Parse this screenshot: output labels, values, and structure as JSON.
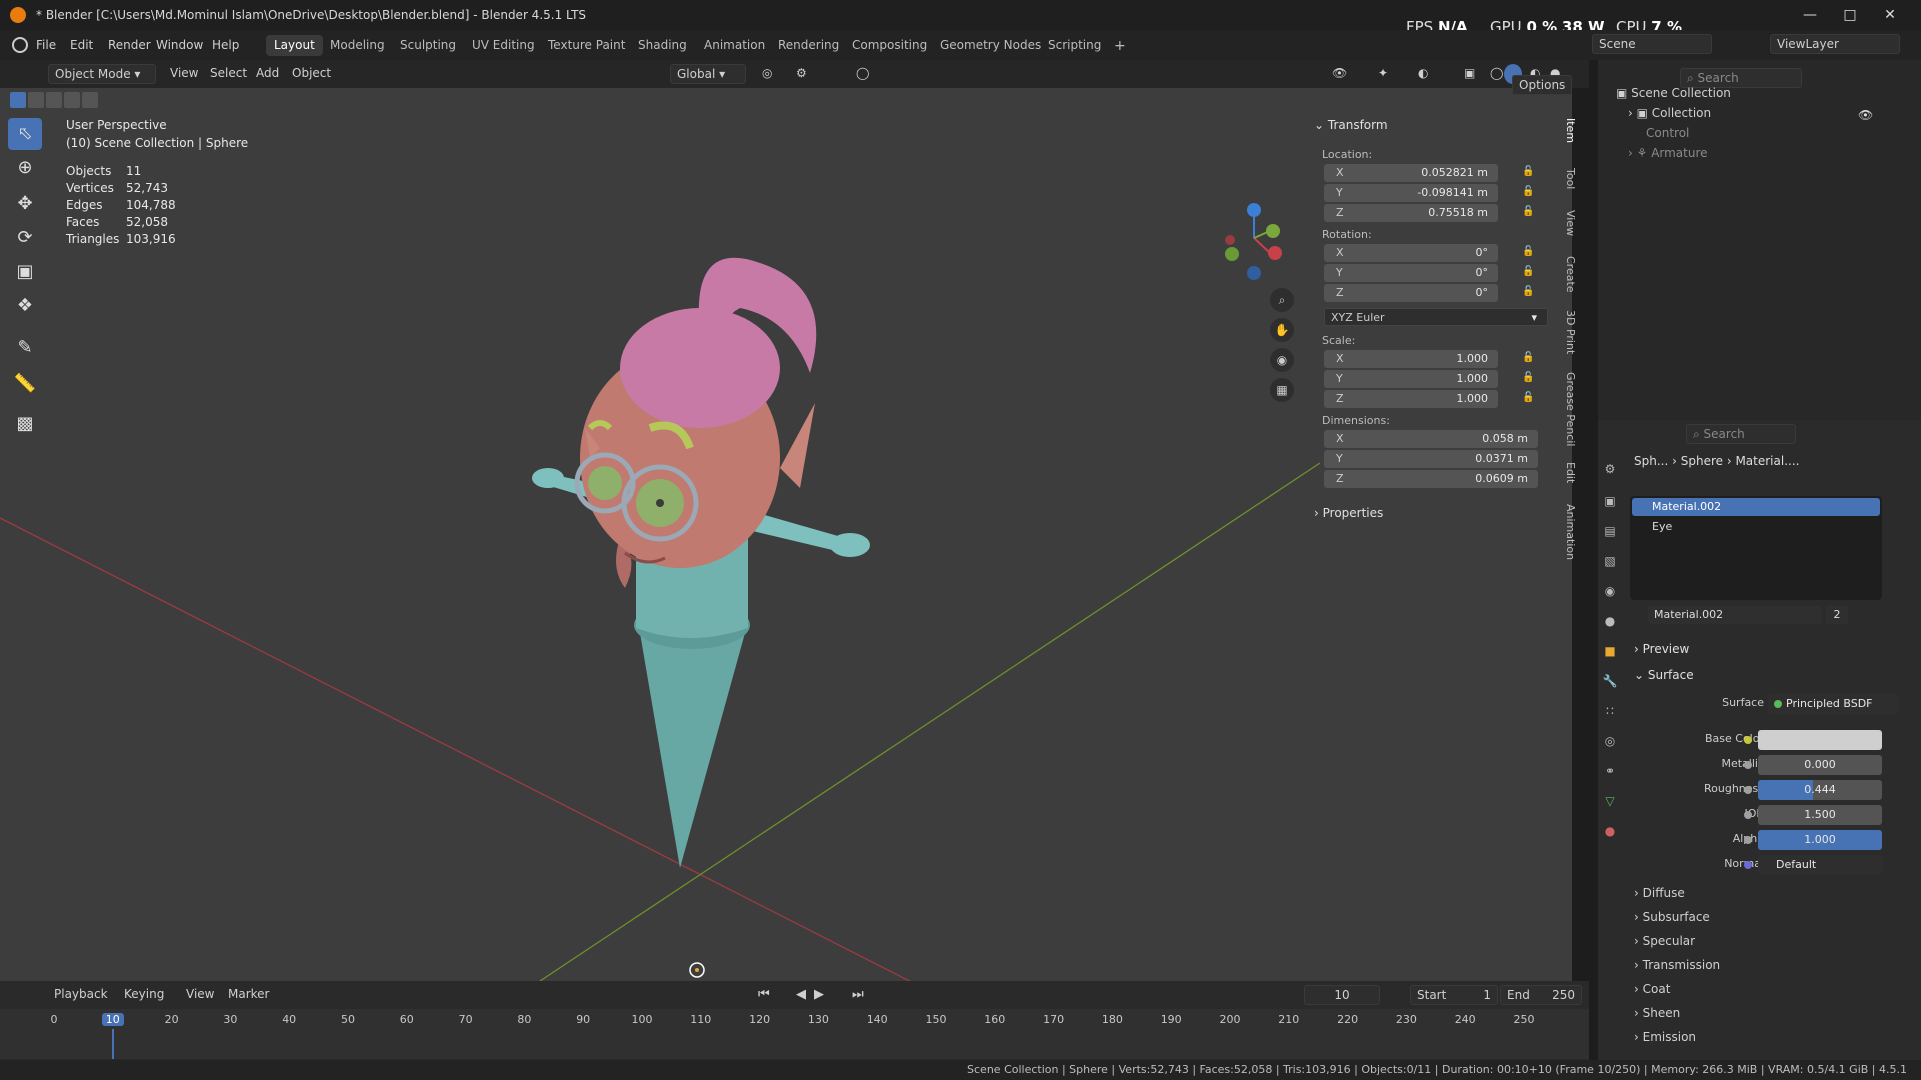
{
  "titlebar": {
    "title": "* Blender [C:\\Users\\Md.Mominul Islam\\OneDrive\\Desktop\\Blender.blend] - Blender 4.5.1 LTS",
    "fps_label": "FPS",
    "fps_value": "N/A",
    "gpu_label": "GPU",
    "gpu_value": "0 %",
    "gpu_power": "38 W",
    "cpu_label": "CPU",
    "cpu_value": "7 %"
  },
  "menubar": {
    "items": [
      "File",
      "Edit",
      "Render",
      "Window",
      "Help"
    ],
    "workspaces": [
      "Layout",
      "Modeling",
      "Sculpting",
      "UV Editing",
      "Texture Paint",
      "Shading",
      "Animation",
      "Rendering",
      "Compositing",
      "Geometry Nodes",
      "Scripting"
    ],
    "scene": "Scene",
    "view_layer": "ViewLayer"
  },
  "vp_header": {
    "mode": "Object Mode",
    "view": "View",
    "select": "Select",
    "add": "Add",
    "object": "Object",
    "orientation": "Global",
    "options": "Options"
  },
  "viewport": {
    "perspective": "User Perspective",
    "collection_line": "(10) Scene Collection | Sphere",
    "stats": [
      {
        "k": "Objects",
        "v": "11"
      },
      {
        "k": "Vertices",
        "v": "52,743"
      },
      {
        "k": "Edges",
        "v": "104,788"
      },
      {
        "k": "Faces",
        "v": "52,058"
      },
      {
        "k": "Triangles",
        "v": "103,916"
      }
    ]
  },
  "npanel": {
    "transform": "Transform",
    "location": "Location:",
    "loc": [
      {
        "ax": "X",
        "v": "0.052821 m"
      },
      {
        "ax": "Y",
        "v": "-0.098141 m"
      },
      {
        "ax": "Z",
        "v": "0.75518 m"
      }
    ],
    "rotation": "Rotation:",
    "rot": [
      {
        "ax": "X",
        "v": "0°"
      },
      {
        "ax": "Y",
        "v": "0°"
      },
      {
        "ax": "Z",
        "v": "0°"
      }
    ],
    "rot_mode": "XYZ Euler",
    "scale": "Scale:",
    "scl": [
      {
        "ax": "X",
        "v": "1.000"
      },
      {
        "ax": "Y",
        "v": "1.000"
      },
      {
        "ax": "Z",
        "v": "1.000"
      }
    ],
    "dimensions": "Dimensions:",
    "dim": [
      {
        "ax": "X",
        "v": "0.058 m"
      },
      {
        "ax": "Y",
        "v": "0.0371 m"
      },
      {
        "ax": "Z",
        "v": "0.0609 m"
      }
    ],
    "properties": "Properties",
    "tabs": [
      "Item",
      "Tool",
      "View",
      "Create",
      "3D Print",
      "Grease Pencil",
      "Edit",
      "Animation"
    ]
  },
  "outliner": {
    "search_placeholder": "Search",
    "rows": [
      "Scene Collection",
      "Collection",
      "Control",
      "Armature"
    ]
  },
  "props": {
    "search_placeholder": "Search",
    "breadcrumb": [
      "Sph...",
      "Sphere",
      "Material...."
    ],
    "slots": [
      "Material.002",
      "Eye"
    ],
    "material_name": "Material.002",
    "users": "2",
    "preview": "Preview",
    "surface_section": "Surface",
    "surface_label": "Surface",
    "surface_value": "Principled BSDF",
    "fields": [
      {
        "label": "Base Color",
        "value": ""
      },
      {
        "label": "Metallic",
        "value": "0.000"
      },
      {
        "label": "Roughness",
        "value": "0.444"
      },
      {
        "label": "IOR",
        "value": "1.500"
      },
      {
        "label": "Alpha",
        "value": "1.000"
      },
      {
        "label": "Normal",
        "value": "Default"
      }
    ],
    "roughness_fill": 0.444,
    "alpha_fill": 1.0,
    "subsections": [
      "Diffuse",
      "Subsurface",
      "Specular",
      "Transmission",
      "Coat",
      "Sheen",
      "Emission"
    ]
  },
  "timeline": {
    "menus": [
      "Playback",
      "Keying",
      "View",
      "Marker"
    ],
    "current": "10",
    "start_label": "Start",
    "start": "1",
    "end_label": "End",
    "end": "250",
    "ticks": [
      "0",
      "10",
      "20",
      "30",
      "40",
      "50",
      "60",
      "70",
      "80",
      "90",
      "100",
      "110",
      "120",
      "130",
      "140",
      "150",
      "160",
      "170",
      "180",
      "190",
      "200",
      "210",
      "220",
      "230",
      "240",
      "250"
    ]
  },
  "status": "Scene Collection | Sphere | Verts:52,743 | Faces:52,058 | Tris:103,916 | Objects:0/11 | Duration: 00:10+10 (Frame 10/250) | Memory: 266.3 MiB | VRAM: 0.5/4.1 GiB | 4.5.1",
  "colors": {
    "accent": "#4772b3",
    "bg": "#3d3d3d",
    "x_axis": "#b5404a",
    "y_axis": "#7aa83a"
  }
}
